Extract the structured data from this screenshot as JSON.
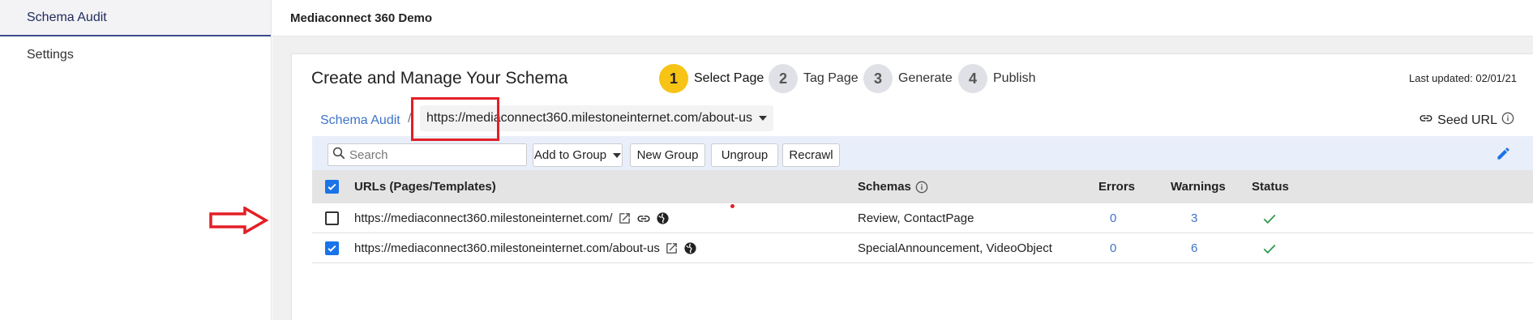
{
  "sidebar": {
    "items": [
      {
        "label": "Schema Audit"
      },
      {
        "label": "Settings"
      }
    ]
  },
  "topbar": {
    "title": "Mediaconnect 360 Demo"
  },
  "card": {
    "title": "Create and Manage Your Schema",
    "last_updated": "Last updated: 02/01/21"
  },
  "steps": [
    {
      "num": "1",
      "label": "Select Page",
      "active": true
    },
    {
      "num": "2",
      "label": "Tag Page"
    },
    {
      "num": "3",
      "label": "Generate"
    },
    {
      "num": "4",
      "label": "Publish"
    }
  ],
  "breadcrumb": {
    "link": "Schema Audit",
    "separator": "/",
    "selected_url": "https://mediaconnect360.milestoneinternet.com/about-us"
  },
  "seed_url": {
    "label": "Seed URL"
  },
  "toolbar": {
    "search_placeholder": "Search",
    "add_to_group": "Add to Group",
    "new_group": "New Group",
    "ungroup": "Ungroup",
    "recrawl": "Recrawl"
  },
  "table": {
    "headers": {
      "urls": "URLs (Pages/Templates)",
      "schemas": "Schemas",
      "errors": "Errors",
      "warnings": "Warnings",
      "status": "Status"
    },
    "rows": [
      {
        "url": "https://mediaconnect360.milestoneinternet.com/",
        "schemas": "Review, ContactPage",
        "errors": "0",
        "warnings": "3",
        "checked": false
      },
      {
        "url": "https://mediaconnect360.milestoneinternet.com/about-us",
        "schemas": "SpecialAnnouncement, VideoObject",
        "errors": "0",
        "warnings": "6",
        "checked": true
      }
    ]
  },
  "colors": {
    "accent": "#3f74c8",
    "step_active": "#f7c315",
    "highlight": "#e31f26",
    "status_ok": "#2e9b4a"
  }
}
